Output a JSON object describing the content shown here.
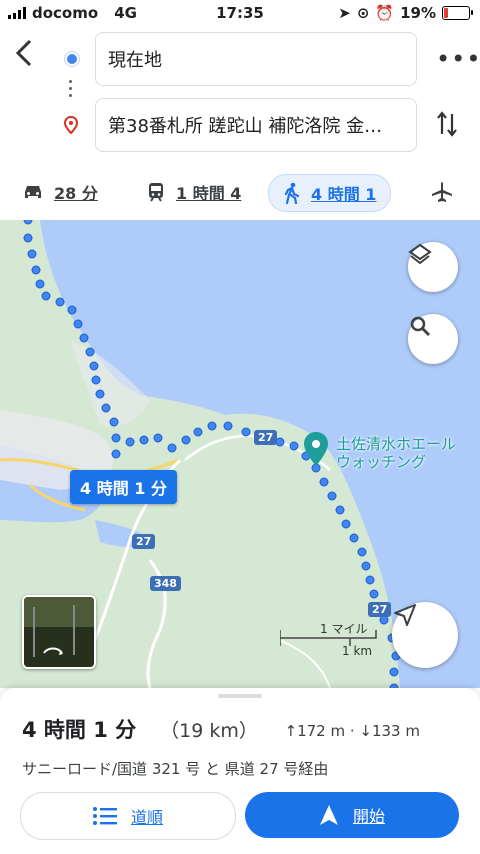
{
  "status": {
    "carrier": "docomo",
    "network": "4G",
    "time": "17:35",
    "battery": "19%"
  },
  "search": {
    "origin": "現在地",
    "destination": "第38番札所 蹉跎山 補陀洛院 金…"
  },
  "modes": [
    {
      "name": "car",
      "label": "28 分"
    },
    {
      "name": "transit",
      "label": "1 時間 4"
    },
    {
      "name": "walk",
      "label": "4 時間 1"
    },
    {
      "name": "flight",
      "label": ""
    }
  ],
  "map": {
    "route_label": "4 時間 1 分",
    "poi_name_line1": "土佐清水ホエール",
    "poi_name_line2": "ウォッチング",
    "road_27": "27",
    "road_348": "348",
    "scale_miles": "1 マイル",
    "scale_km": "1 km"
  },
  "summary": {
    "duration": "4 時間 1 分",
    "distance": "（19 km）",
    "ascent": "↑172 m",
    "descent": "↓133 m",
    "via": "サニーロード/国道 321 号 と 県道 27 号経由"
  },
  "actions": {
    "steps": "道順",
    "start": "開始"
  },
  "colors": {
    "accent": "#1a73e8",
    "land": "#d5e8d4",
    "water": "#aecbfa",
    "poi": "#1e9e9a"
  }
}
